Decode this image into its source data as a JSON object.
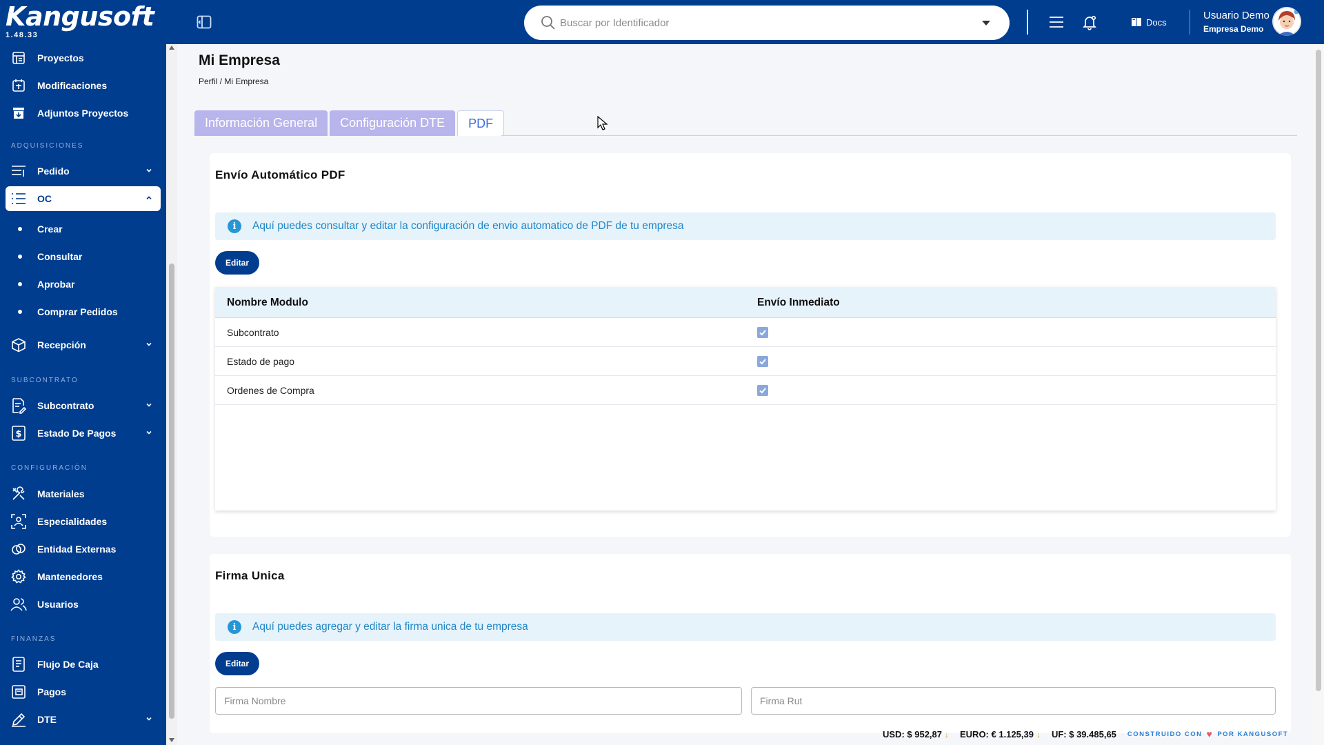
{
  "brand": {
    "name": "Kangusoft",
    "version": "1.48.33"
  },
  "search": {
    "placeholder": "Buscar por Identificador"
  },
  "header": {
    "docs_label": "Docs",
    "user_name": "Usuario Demo",
    "user_company": "Empresa Demo"
  },
  "sidebar": {
    "top_items": [
      {
        "label": "Proyectos",
        "icon": "projects-icon"
      },
      {
        "label": "Modificaciones",
        "icon": "modifications-icon"
      },
      {
        "label": "Adjuntos Proyectos",
        "icon": "attachments-icon"
      }
    ],
    "sections": {
      "adquisiciones": "ADQUISICIONES",
      "subcontrato": "SUBCONTRATO",
      "configuracion": "CONFIGURACIÓN",
      "finanzas": "FINANZAS"
    },
    "adquisiciones_items": [
      {
        "label": "Pedido",
        "icon": "list-icon"
      },
      {
        "label": "OC",
        "icon": "list-check-icon"
      }
    ],
    "oc_subitems": [
      "Crear",
      "Consultar",
      "Aprobar",
      "Comprar Pedidos"
    ],
    "recepcion": {
      "label": "Recepción",
      "icon": "box-icon"
    },
    "subcontrato_items": [
      {
        "label": "Subcontrato",
        "icon": "document-edit-icon"
      },
      {
        "label": "Estado De Pagos",
        "icon": "dollar-icon"
      }
    ],
    "configuracion_items": [
      {
        "label": "Materiales",
        "icon": "tools-icon"
      },
      {
        "label": "Especialidades",
        "icon": "user-scan-icon"
      },
      {
        "label": "Entidad Externas",
        "icon": "link-icon"
      },
      {
        "label": "Mantenedores",
        "icon": "gear-icon"
      },
      {
        "label": "Usuarios",
        "icon": "users-icon"
      }
    ],
    "finanzas_items": [
      {
        "label": "Flujo De Caja",
        "icon": "cashflow-icon"
      },
      {
        "label": "Pagos",
        "icon": "payments-icon"
      },
      {
        "label": "DTE",
        "icon": "pen-icon"
      }
    ]
  },
  "page": {
    "title": "Mi Empresa",
    "breadcrumb": "Perfil / Mi Empresa",
    "tabs": [
      {
        "label": "Información General"
      },
      {
        "label": "Configuración DTE"
      },
      {
        "label": "PDF"
      }
    ],
    "active_tab": "PDF"
  },
  "pdf_section": {
    "title": "Envío Automático PDF",
    "info": "Aquí puedes consultar y editar la configuración de envio automatico de PDF de tu empresa",
    "edit_label": "Editar",
    "columns": [
      "Nombre Modulo",
      "Envío Inmediato"
    ],
    "rows": [
      {
        "module": "Subcontrato",
        "immediate": true
      },
      {
        "module": "Estado de pago",
        "immediate": true
      },
      {
        "module": "Ordenes de Compra",
        "immediate": true
      }
    ]
  },
  "firma_section": {
    "title": "Firma Unica",
    "info": "Aquí puedes agregar y editar la firma unica de tu empresa",
    "edit_label": "Editar",
    "name_placeholder": "Firma Nombre",
    "rut_placeholder": "Firma Rut"
  },
  "footer": {
    "usd": "USD: $ 952,87",
    "euro": "EURO: € 1.125,39",
    "uf": "UF: $ 39.485,65",
    "built_prefix": "CONSTRUIDO CON",
    "built_suffix": "POR KANGUSOFT"
  },
  "colors": {
    "primary": "#003d8f",
    "info_bg": "#e6f3fb",
    "info_text": "#1f86c7",
    "tab_inactive": "#b8b4ec"
  }
}
